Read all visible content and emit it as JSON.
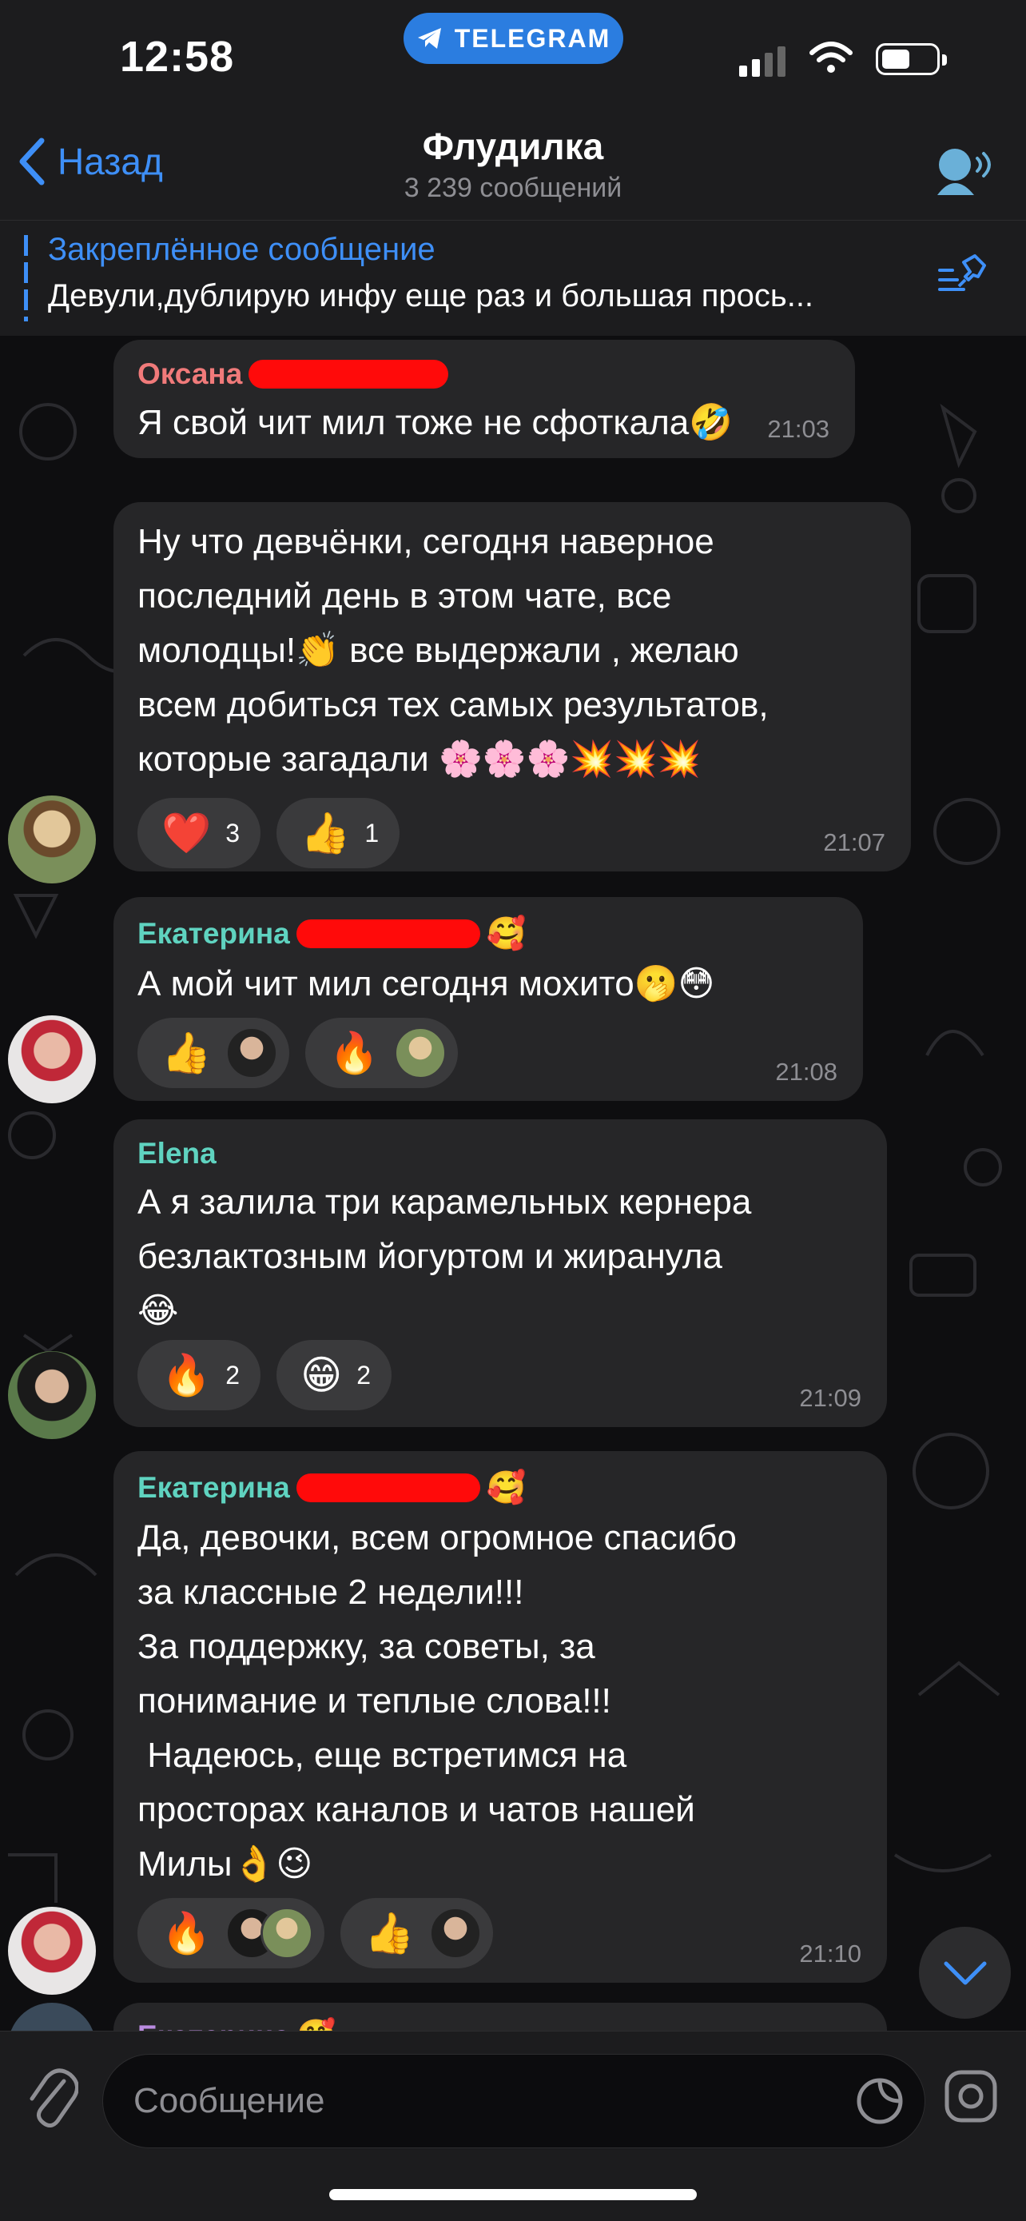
{
  "status_bar": {
    "time": "12:58",
    "pill_label": "TELEGRAM"
  },
  "nav": {
    "back_label": "Назад",
    "title": "Флудилка",
    "subtitle": "3 239 сообщений"
  },
  "pinned": {
    "title": "Закреплённое сообщение",
    "text": "Девули,дублирую инфу еще раз и большая прось..."
  },
  "messages": [
    {
      "sender": "Оксана",
      "sender_color": "#f07a7a",
      "text": "Я свой чит мил тоже не сфоткала🤣",
      "time": "21:03"
    },
    {
      "sender": "",
      "text": "Ну что девчёнки, сегодня наверное\nпоследний день в этом чате, все\nмолодцы!👏 все выдержали , желаю\nвсем добиться тех самых результатов,\nкоторые загадали 🌸🌸🌸💥💥💥",
      "time": "21:07",
      "reactions": [
        {
          "emoji": "❤️",
          "count": "3"
        },
        {
          "emoji": "👍",
          "count": "1"
        }
      ]
    },
    {
      "sender": "Екатерина",
      "sender_color": "#5fd3c0",
      "sender_emoji": "🥰",
      "text": "А мой чит мил сегодня мохито🫢😳",
      "time": "21:08",
      "reactions": [
        {
          "emoji": "👍"
        },
        {
          "emoji": "🔥"
        }
      ]
    },
    {
      "sender": "Elena",
      "sender_color": "#5fd3c0",
      "text": "А я залила три карамельных кернера\nбезлактозным йогуртом и жиранула\n😂",
      "time": "21:09",
      "reactions": [
        {
          "emoji": "🔥",
          "count": "2"
        },
        {
          "emoji": "😁",
          "count": "2"
        }
      ]
    },
    {
      "sender": "Екатерина",
      "sender_color": "#5fd3c0",
      "sender_emoji": "🥰",
      "text": "Да, девочки, всем огромное спасибо\nза классные 2 недели!!!\nЗа поддержку, за советы, за\nпонимание и теплые слова!!!\n Надеюсь, еще встретимся на\nпросторах каналов и чатов нашей\nМилы👌😉",
      "time": "21:10",
      "reactions": [
        {
          "emoji": "🔥"
        },
        {
          "emoji": "👍"
        }
      ]
    },
    {
      "sender": "Екатерина",
      "sender_color": "#b98be0",
      "sender_emoji": "🥰"
    }
  ],
  "input": {
    "placeholder": "Сообщение"
  },
  "colors": {
    "accent": "#3e8ff7",
    "bubble": "#262628",
    "bar": "#1c1c1e"
  }
}
